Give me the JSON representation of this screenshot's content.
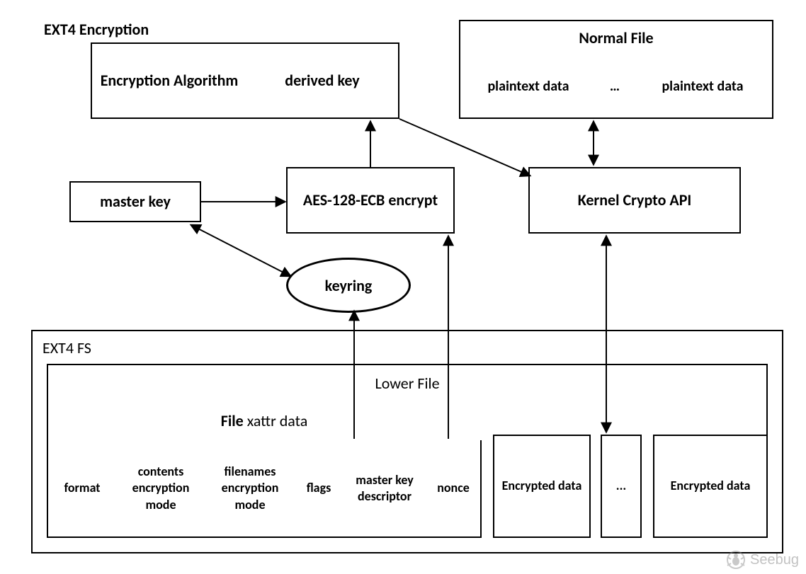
{
  "title": "EXT4 Encryption",
  "top_table": {
    "encryption_algorithm": "Encryption Algorithm",
    "derived_key": "derived key"
  },
  "normal_file": {
    "header": "Normal File",
    "cells": [
      "plaintext data",
      "…",
      "plaintext data"
    ]
  },
  "master_key": "master key",
  "aes_box": "AES-128-ECB encrypt",
  "kernel_crypto": "Kernel Crypto API",
  "keyring": "keyring",
  "ext4fs": {
    "label": "EXT4 FS",
    "lower_file": "Lower File",
    "file_xattr_prefix": "File",
    "file_xattr_suffix": "xattr data",
    "columns": [
      "format",
      "contents encryption mode",
      "filenames encryption mode",
      "flags",
      "master key descriptor",
      "nonce"
    ],
    "extra": [
      "Encrypted data",
      "...",
      "Encrypted data"
    ]
  },
  "watermark": "Seebug"
}
